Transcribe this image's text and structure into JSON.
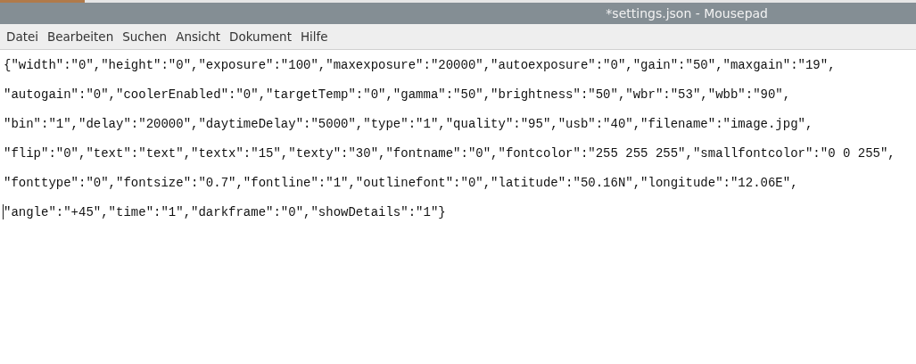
{
  "window": {
    "title": "*settings.json - Mousepad"
  },
  "menu": [
    "Datei",
    "Bearbeiten",
    "Suchen",
    "Ansicht",
    "Dokument",
    "Hilfe"
  ],
  "editor": {
    "lines": [
      {
        "text": "{\"width\":\"0\",\"height\":\"0\",\"exposure\":\"100\",\"maxexposure\":\"20000\",\"autoexposure\":\"0\",\"gain\":\"50\",\"maxgain\":\"19\",",
        "cursor": false
      },
      {
        "text": "\"autogain\":\"0\",\"coolerEnabled\":\"0\",\"targetTemp\":\"0\",\"gamma\":\"50\",\"brightness\":\"50\",\"wbr\":\"53\",\"wbb\":\"90\",",
        "cursor": false
      },
      {
        "text": "\"bin\":\"1\",\"delay\":\"20000\",\"daytimeDelay\":\"5000\",\"type\":\"1\",\"quality\":\"95\",\"usb\":\"40\",\"filename\":\"image.jpg\",",
        "cursor": false
      },
      {
        "text": "\"flip\":\"0\",\"text\":\"text\",\"textx\":\"15\",\"texty\":\"30\",\"fontname\":\"0\",\"fontcolor\":\"255 255 255\",\"smallfontcolor\":\"0 0 255\",",
        "cursor": false
      },
      {
        "text": "\"fonttype\":\"0\",\"fontsize\":\"0.7\",\"fontline\":\"1\",\"outlinefont\":\"0\",\"latitude\":\"50.16N\",\"longitude\":\"12.06E\",",
        "cursor": false
      },
      {
        "text": "\"angle\":\"+45\",\"time\":\"1\",\"darkframe\":\"0\",\"showDetails\":\"1\"}",
        "cursor": true
      }
    ]
  }
}
